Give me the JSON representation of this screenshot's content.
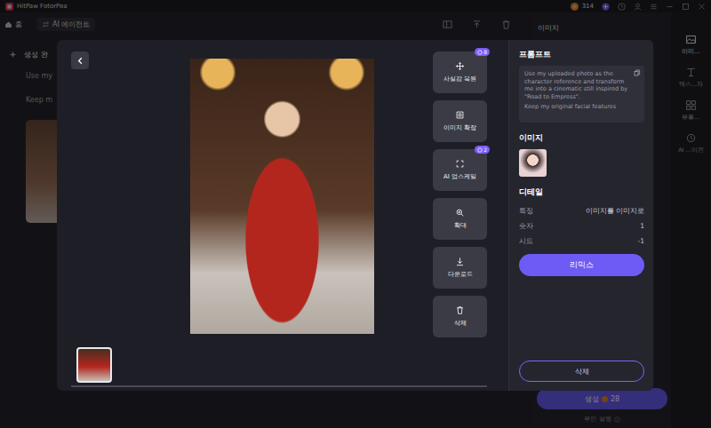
{
  "titlebar": {
    "app_name": "HitPaw FotorPea",
    "credits": "314"
  },
  "toolbar": {
    "home": "홈",
    "breadcrumb": "AI 에이전트"
  },
  "background": {
    "heading": "생성 완",
    "lines": [
      "Use my",
      "Keep m"
    ],
    "panel_title": "이미지",
    "generate": {
      "label": "생성",
      "cost": "28"
    },
    "note": "부인 설명"
  },
  "sidebar": {
    "items": [
      {
        "label": "이미...",
        "selected": true
      },
      {
        "label": "텍스...자",
        "selected": false
      },
      {
        "label": "뷰플...",
        "selected": false
      },
      {
        "label": "AI ...이전",
        "selected": false
      }
    ]
  },
  "modal": {
    "actions": [
      {
        "label": "사실감 복원",
        "badge": "8"
      },
      {
        "label": "이미지 확장",
        "badge": null
      },
      {
        "label": "AI 업스케일",
        "badge": "2"
      },
      {
        "label": "확대",
        "badge": null
      },
      {
        "label": "다운로드",
        "badge": null
      },
      {
        "label": "삭제",
        "badge": null
      }
    ],
    "thumbnails": [
      {
        "selected": true
      }
    ],
    "panel": {
      "prompt_title": "프롬프트",
      "prompt": [
        "Use my uploaded photo as the character reference and transform me into a cinematic still inspired by \"Road to Empress\".",
        "Keep my original facial features"
      ],
      "image_title": "이미지",
      "detail_title": "디테일",
      "details": [
        {
          "label": "특징",
          "value": "이미지를 이미지로"
        },
        {
          "label": "숫자",
          "value": "1"
        },
        {
          "label": "시드",
          "value": "-1"
        }
      ],
      "remix": "리믹스",
      "delete": "삭제"
    }
  }
}
